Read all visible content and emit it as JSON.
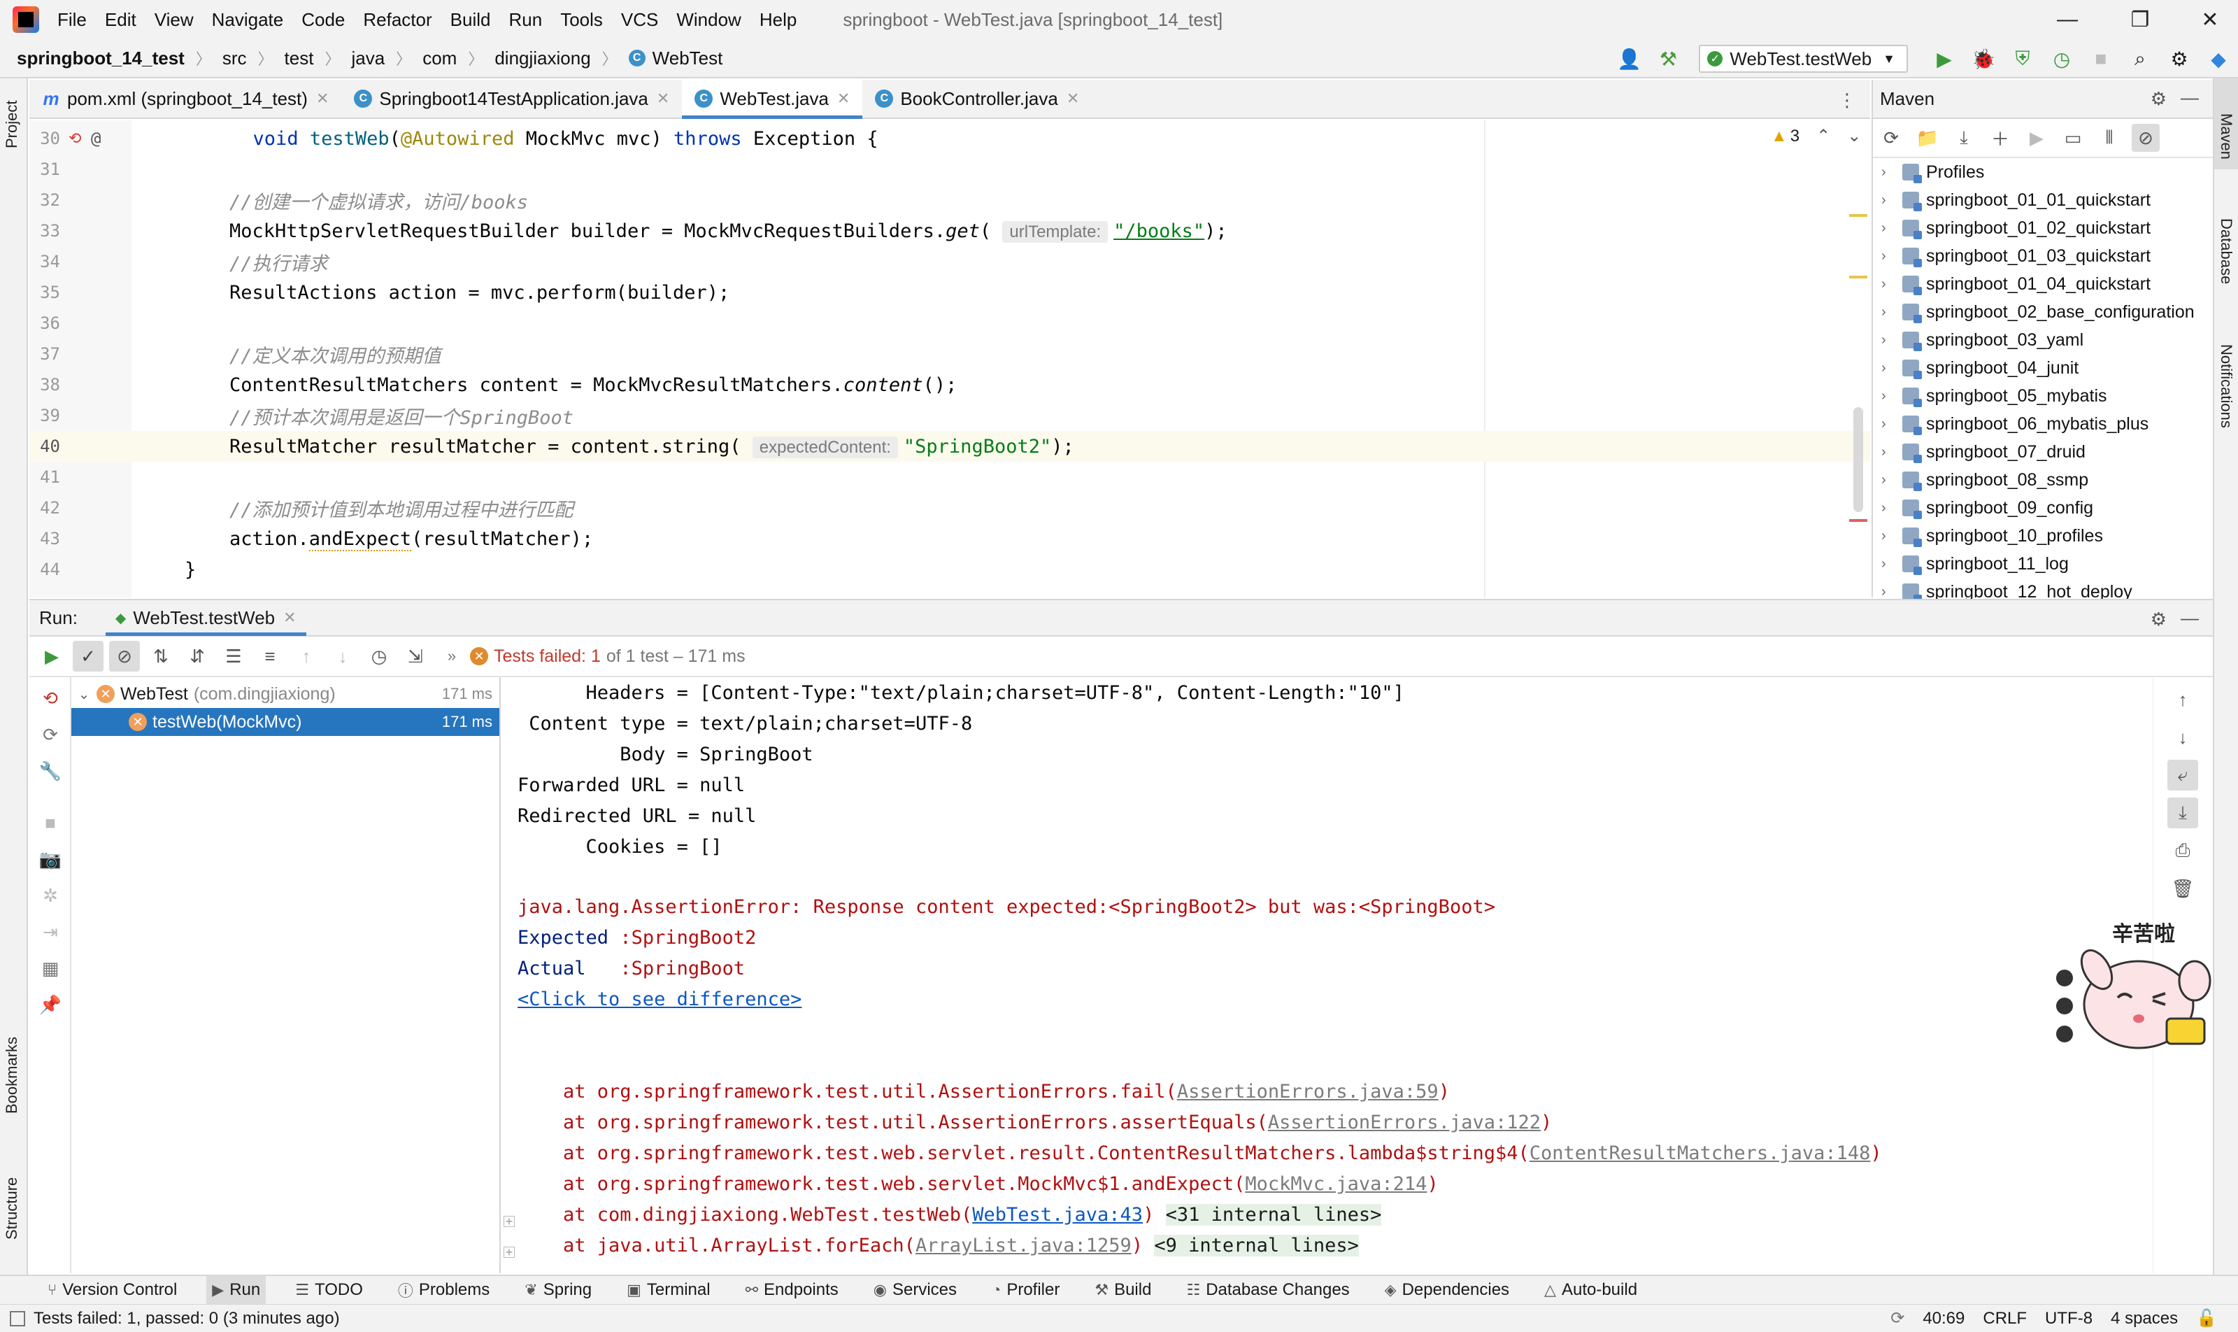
{
  "menu": [
    "File",
    "Edit",
    "View",
    "Navigate",
    "Code",
    "Refactor",
    "Build",
    "Run",
    "Tools",
    "VCS",
    "Window",
    "Help"
  ],
  "window_title": "springboot - WebTest.java [springboot_14_test]",
  "breadcrumbs": [
    "springboot_14_test",
    "src",
    "test",
    "java",
    "com",
    "dingjiaxiong",
    "WebTest"
  ],
  "run_config": "WebTest.testWeb",
  "left_stripe": {
    "project": "Project",
    "bookmarks": "Bookmarks",
    "structure": "Structure"
  },
  "right_stripe": {
    "maven": "Maven",
    "database": "Database",
    "notifications": "Notifications"
  },
  "editor_tabs": [
    {
      "label": "pom.xml (springboot_14_test)",
      "icon": "m"
    },
    {
      "label": "Springboot14TestApplication.java",
      "icon": "C"
    },
    {
      "label": "WebTest.java",
      "icon": "C"
    },
    {
      "label": "BookController.java",
      "icon": "C"
    }
  ],
  "editor": {
    "warnings": "3",
    "lines": [
      "30",
      "31",
      "32",
      "33",
      "34",
      "35",
      "36",
      "37",
      "38",
      "39",
      "40",
      "41",
      "42",
      "43",
      "44"
    ],
    "l30": {
      "kw_void": "void",
      "name": "testWeb",
      "ann": "@Autowired",
      "rest": " MockMvc mvc) ",
      "kw_throws": "throws",
      "tail": " Exception {"
    },
    "l32": "//创建一个虚拟请求，访问/books",
    "l33": {
      "a": "MockHttpServletRequestBuilder builder = MockMvcRequestBuilders.",
      "m": "get",
      "hint": "urlTemplate:",
      "str": "\"/books\"",
      "end": ");"
    },
    "l34": "//执行请求",
    "l35": "ResultActions action = mvc.perform(builder);",
    "l37": "//定义本次调用的预期值",
    "l38": {
      "a": "ContentResultMatchers content = MockMvcResultMatchers.",
      "m": "content",
      "end": "();"
    },
    "l39": "//预计本次调用是返回一个SpringBoot",
    "l40": {
      "a": "ResultMatcher resultMatcher = content.string(",
      "hint": "expectedContent:",
      "str": "\"SpringBoot2\"",
      "end": ");"
    },
    "l42": "//添加预计值到本地调用过程中进行匹配",
    "l43": {
      "a": "action.",
      "m": "andExpect",
      "end": "(resultMatcher);"
    },
    "l44": "}"
  },
  "maven": {
    "title": "Maven",
    "items": [
      "Profiles",
      "springboot_01_01_quickstart",
      "springboot_01_02_quickstart",
      "springboot_01_03_quickstart",
      "springboot_01_04_quickstart",
      "springboot_02_base_configuration",
      "springboot_03_yaml",
      "springboot_04_junit",
      "springboot_05_mybatis",
      "springboot_06_mybatis_plus",
      "springboot_07_druid",
      "springboot_08_ssmp",
      "springboot_09_config",
      "springboot_10_profiles",
      "springboot_11_log",
      "springboot_12_hot_deploy"
    ]
  },
  "run": {
    "label": "Run:",
    "tab": "WebTest.testWeb",
    "status_failed": "Tests failed: 1",
    "status_rest": "of 1 test – 171 ms",
    "tree": [
      {
        "name": "WebTest",
        "pkg": "(com.dingjiaxiong)",
        "time": "171 ms"
      },
      {
        "name": "testWeb(MockMvc)",
        "time": "171 ms"
      }
    ]
  },
  "console": {
    "headers": "      Headers = [Content-Type:\"text/plain;charset=UTF-8\", Content-Length:\"10\"]",
    "ctype": " Content type = text/plain;charset=UTF-8",
    "body": "         Body = SpringBoot",
    "fwd": "Forwarded URL = null",
    "redir": "Redirected URL = null",
    "cookies": "      Cookies = []",
    "error": "java.lang.AssertionError: Response content expected:<SpringBoot2> but was:<SpringBoot>",
    "expected_label": "Expected ",
    "expected_val": ":SpringBoot2",
    "actual_label": "Actual   ",
    "actual_val": ":SpringBoot",
    "diff_link": "<Click to see difference>",
    "stack": [
      {
        "pre": "    at org.springframework.test.util.AssertionErrors.fail(",
        "link": "AssertionErrors.java:59",
        "post": ")",
        "extra": ""
      },
      {
        "pre": "    at org.springframework.test.util.AssertionErrors.assertEquals(",
        "link": "AssertionErrors.java:122",
        "post": ")",
        "extra": ""
      },
      {
        "pre": "    at org.springframework.test.web.servlet.result.ContentResultMatchers.lambda$string$4(",
        "link": "ContentResultMatchers.java:148",
        "post": ")",
        "extra": ""
      },
      {
        "pre": "    at org.springframework.test.web.servlet.MockMvc$1.andExpect(",
        "link": "MockMvc.java:214",
        "post": ")",
        "extra": ""
      },
      {
        "pre": "    at com.dingjiaxiong.WebTest.testWeb(",
        "link": "WebTest.java:43",
        "post": ") ",
        "extra": "<31 internal lines>"
      },
      {
        "pre": "    at java.util.ArrayList.forEach(",
        "link": "ArrayList.java:1259",
        "post": ") ",
        "extra": "<9 internal lines>"
      }
    ]
  },
  "sticker_text": "辛苦啦",
  "bottom_tools": [
    "Version Control",
    "Run",
    "TODO",
    "Problems",
    "Spring",
    "Terminal",
    "Endpoints",
    "Services",
    "Profiler",
    "Build",
    "Database Changes",
    "Dependencies",
    "Auto-build"
  ],
  "statusbar": {
    "message": "Tests failed: 1, passed: 0 (3 minutes ago)",
    "pos": "40:69",
    "eol": "CRLF",
    "enc": "UTF-8",
    "indent": "4 spaces"
  },
  "colors": {
    "accent": "#4083c9",
    "selection": "#2675bf",
    "error": "#b01010",
    "string": "#067d17",
    "keyword": "#0033b3"
  }
}
